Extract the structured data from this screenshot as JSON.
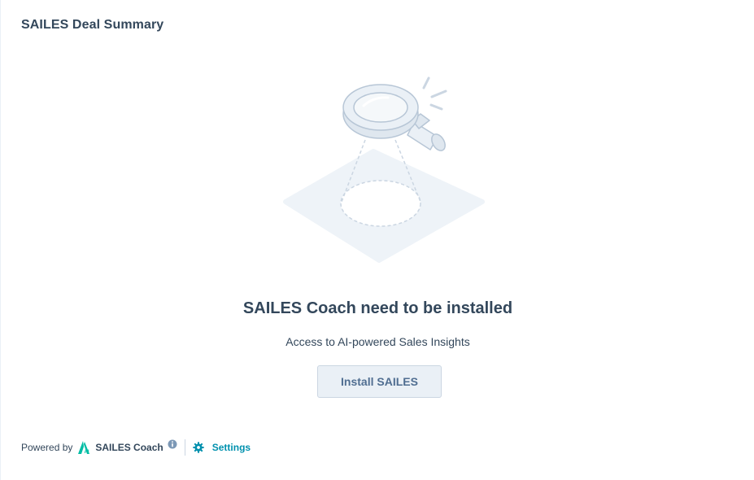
{
  "card": {
    "title": "SAILES Deal Summary"
  },
  "empty_state": {
    "heading": "SAILES Coach need to be installed",
    "subtext": "Access to AI-powered Sales Insights",
    "install_label": "Install SAILES",
    "illustration_icon": "magnifying-glass-illustration"
  },
  "footer": {
    "powered_label": "Powered by",
    "logo_icon": "sailes-logo-icon",
    "brand_name": "SAILES Coach",
    "info_icon": "info-icon",
    "settings_icon": "gear-icon",
    "settings_label": "Settings"
  },
  "colors": {
    "text": "#33475b",
    "link": "#0091ae",
    "button_bg": "#eaf0f6",
    "button_border": "#cbd6e2",
    "logo": "#00bda5"
  }
}
